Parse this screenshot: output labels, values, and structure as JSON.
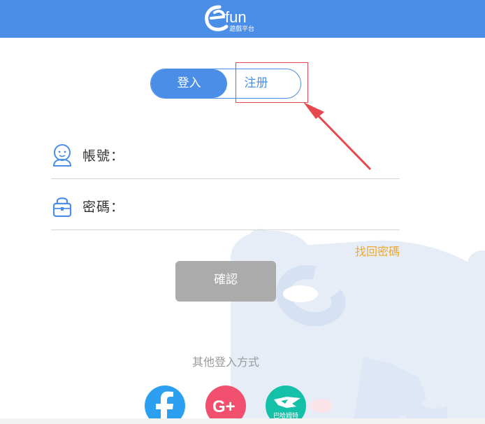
{
  "colors": {
    "header": "#4a8ee8",
    "accent": "#4a8ee8",
    "forgot": "#f0a92c",
    "confirm": "#ababab",
    "highlight": "#e5484d"
  },
  "header": {
    "logo_text": "fun",
    "logo_sub": "遊戲平台",
    "logo_icon": "efun-logo-icon"
  },
  "tabs": {
    "login": "登入",
    "register": "注册"
  },
  "form": {
    "account_label": "帳號：",
    "account_value": "",
    "password_label": "密碼：",
    "password_value": ""
  },
  "forgot_password": "找回密碼",
  "confirm_button": "確認",
  "other_login": {
    "title": "其他登入方式",
    "providers": [
      {
        "name": "facebook",
        "icon": "facebook-icon"
      },
      {
        "name": "google-plus",
        "icon": "google-plus-icon"
      },
      {
        "name": "mobo",
        "icon": "mobo-icon",
        "label": "巴哈姆特"
      }
    ]
  }
}
